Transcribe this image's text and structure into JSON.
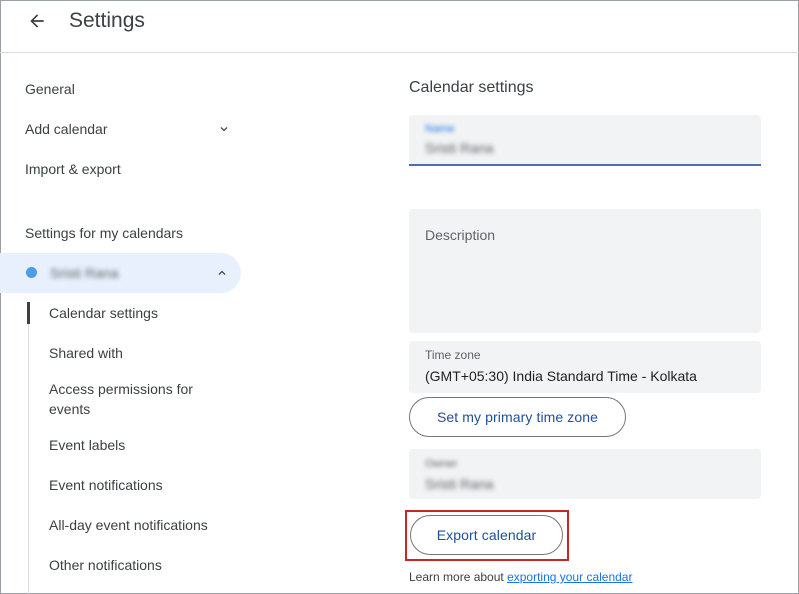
{
  "header": {
    "title": "Settings",
    "back_icon": "arrow-left-icon"
  },
  "sidebar": {
    "items": [
      {
        "label": "General"
      },
      {
        "label": "Add calendar"
      },
      {
        "label": "Import & export"
      }
    ],
    "my_calendars_heading": "Settings for my calendars",
    "calendar": {
      "name": "Sristi Rana",
      "color": "#4a9de8"
    },
    "sub_items": [
      {
        "label": "Calendar settings"
      },
      {
        "label": "Shared with"
      },
      {
        "label": "Access permissions for events"
      },
      {
        "label": "Event labels"
      },
      {
        "label": "Event notifications"
      },
      {
        "label": "All-day event notifications"
      },
      {
        "label": "Other notifications"
      }
    ]
  },
  "main": {
    "section_title": "Calendar settings",
    "name_field": {
      "label": "Name",
      "value": "Sristi Rana"
    },
    "description_field": {
      "placeholder": "Description"
    },
    "timezone_field": {
      "label": "Time zone",
      "value": "(GMT+05:30) India Standard Time - Kolkata"
    },
    "primary_tz_button": "Set my primary time zone",
    "owner_field": {
      "label": "Owner",
      "value": "Sristi Rana"
    },
    "export_button": "Export calendar",
    "learn_more": {
      "text": "Learn more about ",
      "link": "exporting your calendar"
    }
  },
  "colors": {
    "accent": "#1a73e8",
    "highlight": "#c62828",
    "selected_bg": "#e8f0fe"
  }
}
